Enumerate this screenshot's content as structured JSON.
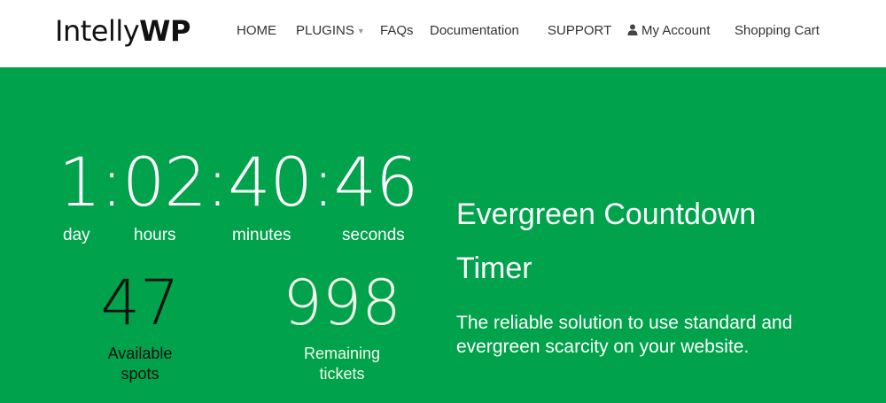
{
  "header": {
    "logo_part1": "Intelly",
    "logo_part2": "WP",
    "nav": {
      "home": "HOME",
      "plugins": "PLUGINS",
      "faqs": "FAQs",
      "documentation": "Documentation",
      "support": "SUPPORT",
      "my_account": "My Account",
      "shopping_cart": "Shopping Cart"
    }
  },
  "countdown": {
    "display": "1:02:40:46",
    "days": "1",
    "hours": "02",
    "minutes": "40",
    "seconds": "46",
    "labels": {
      "day": "day",
      "hours": "hours",
      "minutes": "minutes",
      "seconds": "seconds"
    }
  },
  "stats": {
    "available": {
      "value": "47",
      "label_line1": "Available",
      "label_line2": "spots"
    },
    "remaining": {
      "value": "998",
      "label_line1": "Remaining",
      "label_line2": "tickets"
    }
  },
  "hero": {
    "title_line1": "Evergreen Countdown",
    "title_line2": "Timer",
    "subtitle_line1": "The reliable solution to use standard and",
    "subtitle_line2": "evergreen scarcity on your website."
  },
  "colors": {
    "hero_background": "#00a24b",
    "available_text": "#111111",
    "remaining_text": "#f2f7ea"
  },
  "icons": {
    "caret": "chevron-down-icon",
    "account": "user-icon"
  }
}
